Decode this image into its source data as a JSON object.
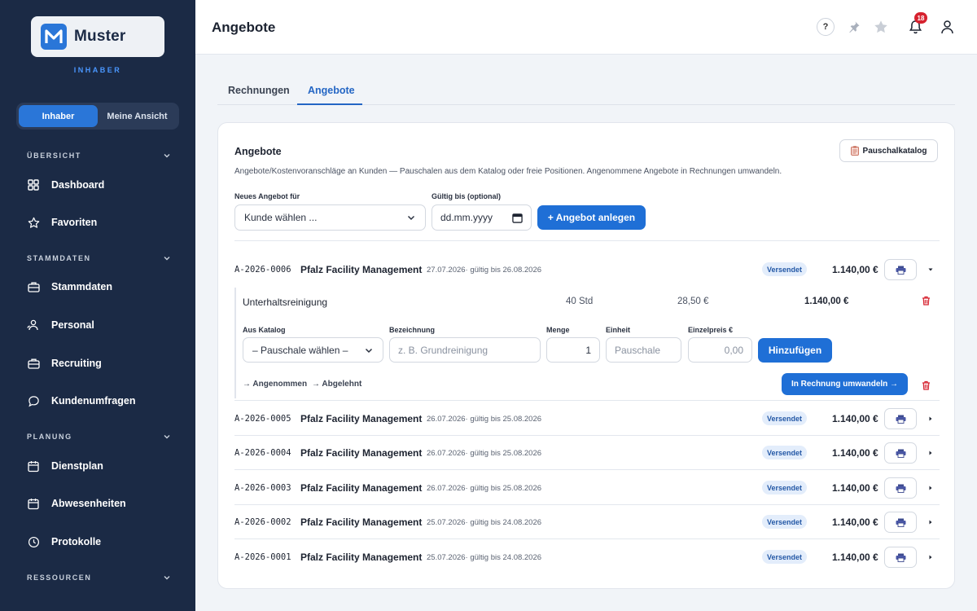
{
  "brand": {
    "name": "Muster",
    "role": "INHABER"
  },
  "view_toggle": {
    "owner": "Inhaber",
    "mine": "Meine Ansicht"
  },
  "sidebar": {
    "sections": {
      "overview": "ÜBERSICHT",
      "master": "STAMMDATEN",
      "planning": "PLANUNG",
      "resources": "RESSOURCEN"
    },
    "items": {
      "dashboard": "Dashboard",
      "favorites": "Favoriten",
      "masterdata": "Stammdaten",
      "personnel": "Personal",
      "recruiting": "Recruiting",
      "surveys": "Kundenumfragen",
      "shiftplan": "Dienstplan",
      "absences": "Abwesenheiten",
      "logs": "Protokolle"
    }
  },
  "header": {
    "title": "Angebote",
    "help": "?",
    "notifications": "18"
  },
  "tabs": {
    "invoices": "Rechnungen",
    "offers": "Angebote"
  },
  "card": {
    "title": "Angebote",
    "description": "Angebote/Kostenvoranschläge an Kunden — Pauschalen aus dem Katalog oder freie Positionen. Angenommene Angebote in Rechnungen umwandeln.",
    "catalog_button": "Pauschalkatalog",
    "new_for_label": "Neues Angebot für",
    "customer_select": "Kunde wählen ...",
    "valid_until_label": "Gültig bis (optional)",
    "date_placeholder": "dd.mm.yyyy",
    "create_button": "+ Angebot anlegen"
  },
  "expanded": {
    "position": {
      "name": "Unterhaltsreinigung",
      "qty": "40 Std",
      "price": "28,50 €",
      "total": "1.140,00 €"
    },
    "labels": {
      "catalog": "Aus Katalog",
      "name": "Bezeichnung",
      "qty": "Menge",
      "unit": "Einheit",
      "price": "Einzelpreis €"
    },
    "catalog_select": "– Pauschale wählen –",
    "name_placeholder": "z. B. Grundreinigung",
    "qty_value": "1",
    "unit_placeholder": "Pauschale",
    "price_placeholder": "0,00",
    "add_button": "Hinzufügen",
    "accepted_link": "→ Angenommen",
    "rejected_link": "→ Abgelehnt",
    "convert_button": "In Rechnung umwandeln →"
  },
  "offers": [
    {
      "number": "A-2026-0006",
      "customer": "Pfalz Facility Management",
      "dates": "27.07.2026· gültig bis 26.08.2026",
      "status": "Versendet",
      "amount": "1.140,00 €"
    },
    {
      "number": "A-2026-0005",
      "customer": "Pfalz Facility Management",
      "dates": "26.07.2026· gültig bis 25.08.2026",
      "status": "Versendet",
      "amount": "1.140,00 €"
    },
    {
      "number": "A-2026-0004",
      "customer": "Pfalz Facility Management",
      "dates": "26.07.2026· gültig bis 25.08.2026",
      "status": "Versendet",
      "amount": "1.140,00 €"
    },
    {
      "number": "A-2026-0003",
      "customer": "Pfalz Facility Management",
      "dates": "26.07.2026· gültig bis 25.08.2026",
      "status": "Versendet",
      "amount": "1.140,00 €"
    },
    {
      "number": "A-2026-0002",
      "customer": "Pfalz Facility Management",
      "dates": "25.07.2026· gültig bis 24.08.2026",
      "status": "Versendet",
      "amount": "1.140,00 €"
    },
    {
      "number": "A-2026-0001",
      "customer": "Pfalz Facility Management",
      "dates": "25.07.2026· gültig bis 24.08.2026",
      "status": "Versendet",
      "amount": "1.140,00 €"
    }
  ],
  "colors": {
    "sidebar": "#1b2a45",
    "accent": "#1f6fd6",
    "status_bg": "#e3edfb",
    "danger": "#d6222f"
  }
}
